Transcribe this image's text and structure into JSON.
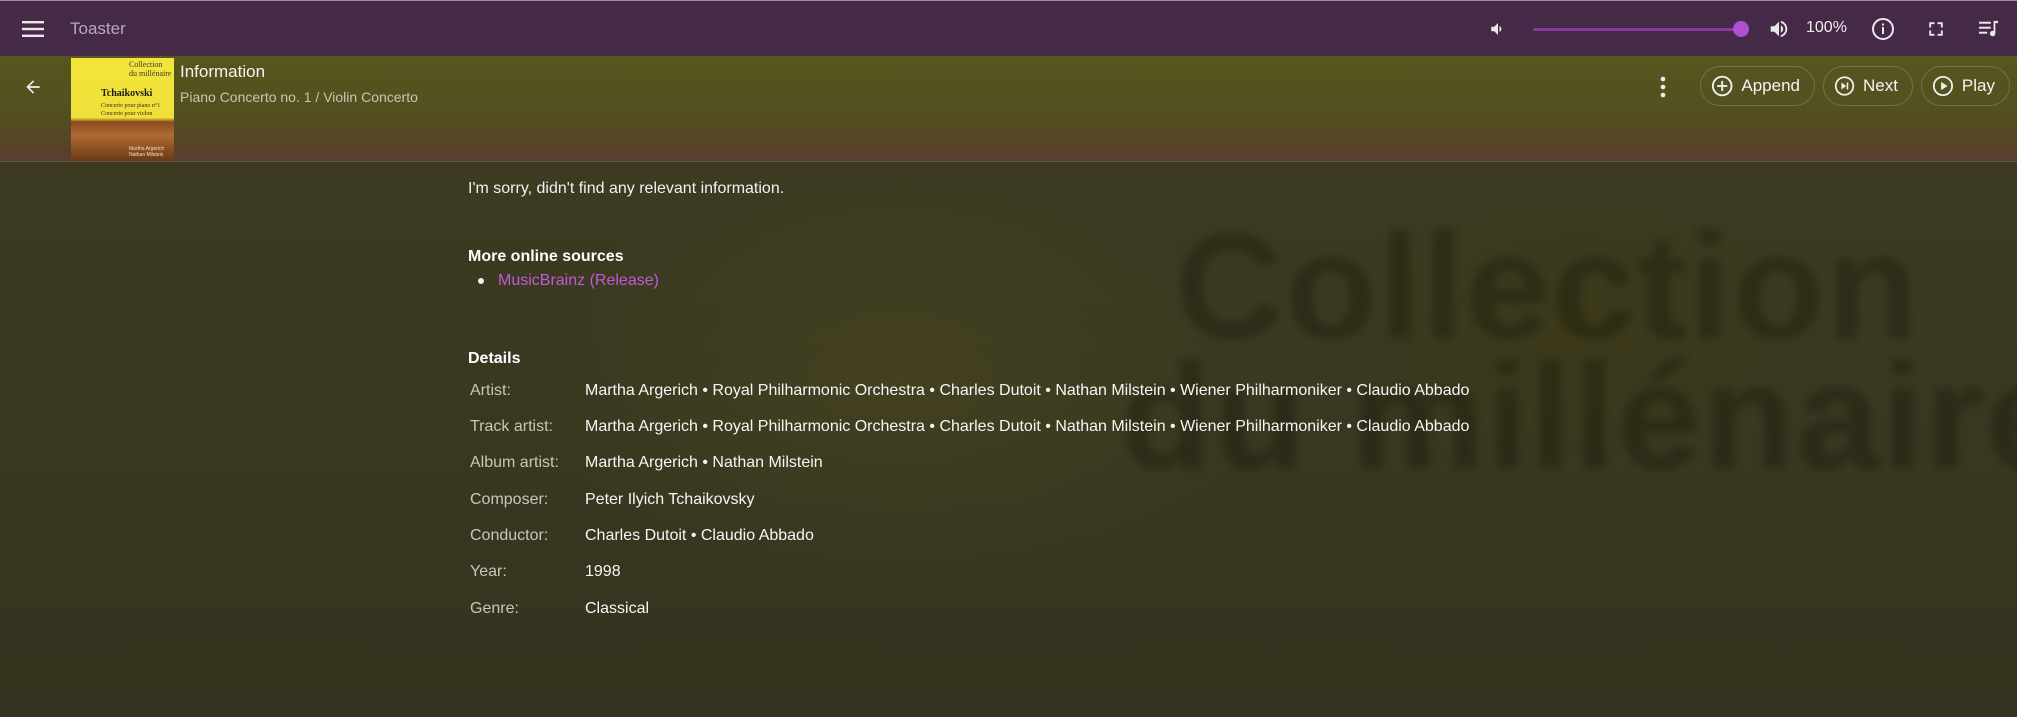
{
  "app": {
    "title": "Toaster"
  },
  "player": {
    "volume": "100%"
  },
  "header": {
    "title": "Information",
    "subtitle": "Piano Concerto no. 1 / Violin Concerto",
    "cover": {
      "line1": "Collection",
      "line2": "du millénaire",
      "composer": "Tchaikovski",
      "sub1": "Concerto pour piano n°1",
      "sub2": "Concerto pour violon",
      "artists1": "Martha Argerich",
      "artists2": "Nathan Milstein"
    },
    "actions": {
      "append": "Append",
      "next": "Next",
      "play": "Play"
    }
  },
  "content": {
    "message": "I'm sorry, didn't find any relevant information.",
    "sources_heading": "More online sources",
    "sources": [
      {
        "label": "MusicBrainz (Release)"
      }
    ],
    "details_heading": "Details",
    "details": [
      {
        "label": "Artist:",
        "value": "Martha Argerich • Royal Philharmonic Orchestra • Charles Dutoit • Nathan Milstein • Wiener Philharmoniker • Claudio Abbado"
      },
      {
        "label": "Track artist:",
        "value": "Martha Argerich • Royal Philharmonic Orchestra • Charles Dutoit • Nathan Milstein • Wiener Philharmoniker • Claudio Abbado"
      },
      {
        "label": "Album artist:",
        "value": "Martha Argerich • Nathan Milstein"
      },
      {
        "label": "Composer:",
        "value": "Peter Ilyich Tchaikovsky"
      },
      {
        "label": "Conductor:",
        "value": "Charles Dutoit • Claudio Abbado"
      },
      {
        "label": "Year:",
        "value": "1998"
      },
      {
        "label": "Genre:",
        "value": "Classical"
      }
    ]
  },
  "background": {
    "line1": "Collection",
    "line2": "du millénaire"
  }
}
